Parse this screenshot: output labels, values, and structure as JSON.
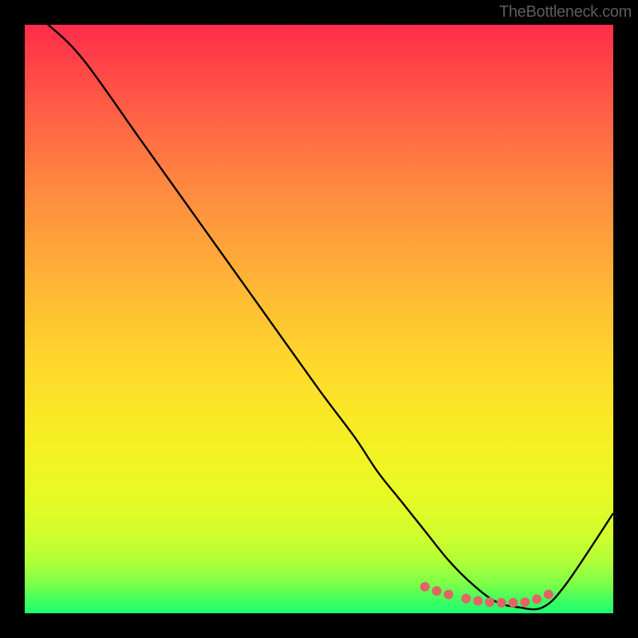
{
  "watermark": "TheBottleneck.com",
  "chart_data": {
    "type": "line",
    "title": "",
    "xlabel": "",
    "ylabel": "",
    "xlim": [
      0,
      100
    ],
    "ylim": [
      0,
      100
    ],
    "series": [
      {
        "name": "bottleneck-curve",
        "x": [
          0,
          4,
          10,
          20,
          30,
          40,
          50,
          56,
          60,
          64,
          68,
          72,
          76,
          80,
          84,
          88,
          92,
          100
        ],
        "y": [
          103,
          100,
          94,
          80,
          66,
          52,
          38,
          30,
          24,
          19,
          14,
          9,
          5,
          2,
          1,
          1,
          5,
          17
        ],
        "color": "#000000"
      },
      {
        "name": "optimal-range-dots",
        "x": [
          68,
          70,
          72,
          75,
          77,
          79,
          81,
          83,
          85,
          87,
          89
        ],
        "y": [
          4.5,
          3.8,
          3.2,
          2.5,
          2.1,
          1.9,
          1.8,
          1.8,
          1.9,
          2.4,
          3.2
        ],
        "color": "#e06666"
      }
    ]
  }
}
